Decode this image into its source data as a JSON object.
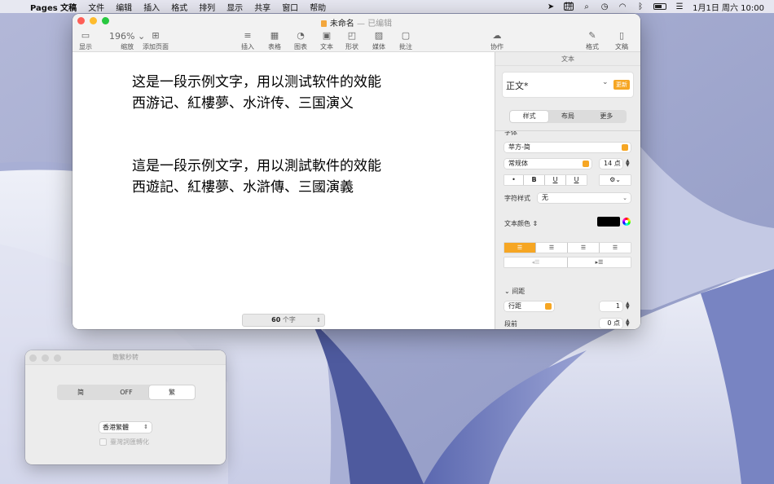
{
  "menubar": {
    "app": "Pages 文稿",
    "items": [
      "文件",
      "编辑",
      "插入",
      "格式",
      "排列",
      "显示",
      "共享",
      "窗口",
      "帮助"
    ],
    "ime": "拼",
    "clock": "1月1日 周六  10:00"
  },
  "window": {
    "title": "未命名",
    "separator": "—",
    "status": "已编辑",
    "toolbar": {
      "view": "显示",
      "zoom_value": "196%",
      "zoom": "缩放",
      "add_page": "添加页面",
      "insert": "插入",
      "table": "表格",
      "chart": "图表",
      "text": "文本",
      "shape": "形状",
      "media": "媒体",
      "comment": "批注",
      "collaborate": "协作",
      "format": "格式",
      "document": "文稿"
    },
    "document": {
      "para1_line1": "这是一段示例文字，用以测试软件的效能",
      "para1_line2": "西游记、紅樓夢、水浒传、三国演义",
      "para2_line1": "這是一段示例文字，用以測試軟件的效能",
      "para2_line2": "西遊記、紅樓夢、水滸傳、三國演義"
    },
    "word_count": {
      "value": "60",
      "unit": "个字"
    }
  },
  "inspector": {
    "header": "文本",
    "paragraph_style": "正文*",
    "update": "更新",
    "tabs": [
      "样式",
      "布局",
      "更多"
    ],
    "font_label": "字体",
    "font": "苹方-简",
    "typeface": "常规体",
    "size": "14 点",
    "char_style_label": "字符样式",
    "char_style": "无",
    "text_color_label": "文本颜色",
    "text_color": "#000000",
    "spacing_label": "间距",
    "line_spacing_mode": "行距",
    "line_spacing_value": "1",
    "before_label": "段前",
    "before_value": "0 点"
  },
  "converter": {
    "title": "簡繁秒转",
    "segments": [
      "简",
      "OFF",
      "繁"
    ],
    "selected": "繁",
    "variant": "香港繁體",
    "checkbox": "臺灣詞匯轉化"
  }
}
